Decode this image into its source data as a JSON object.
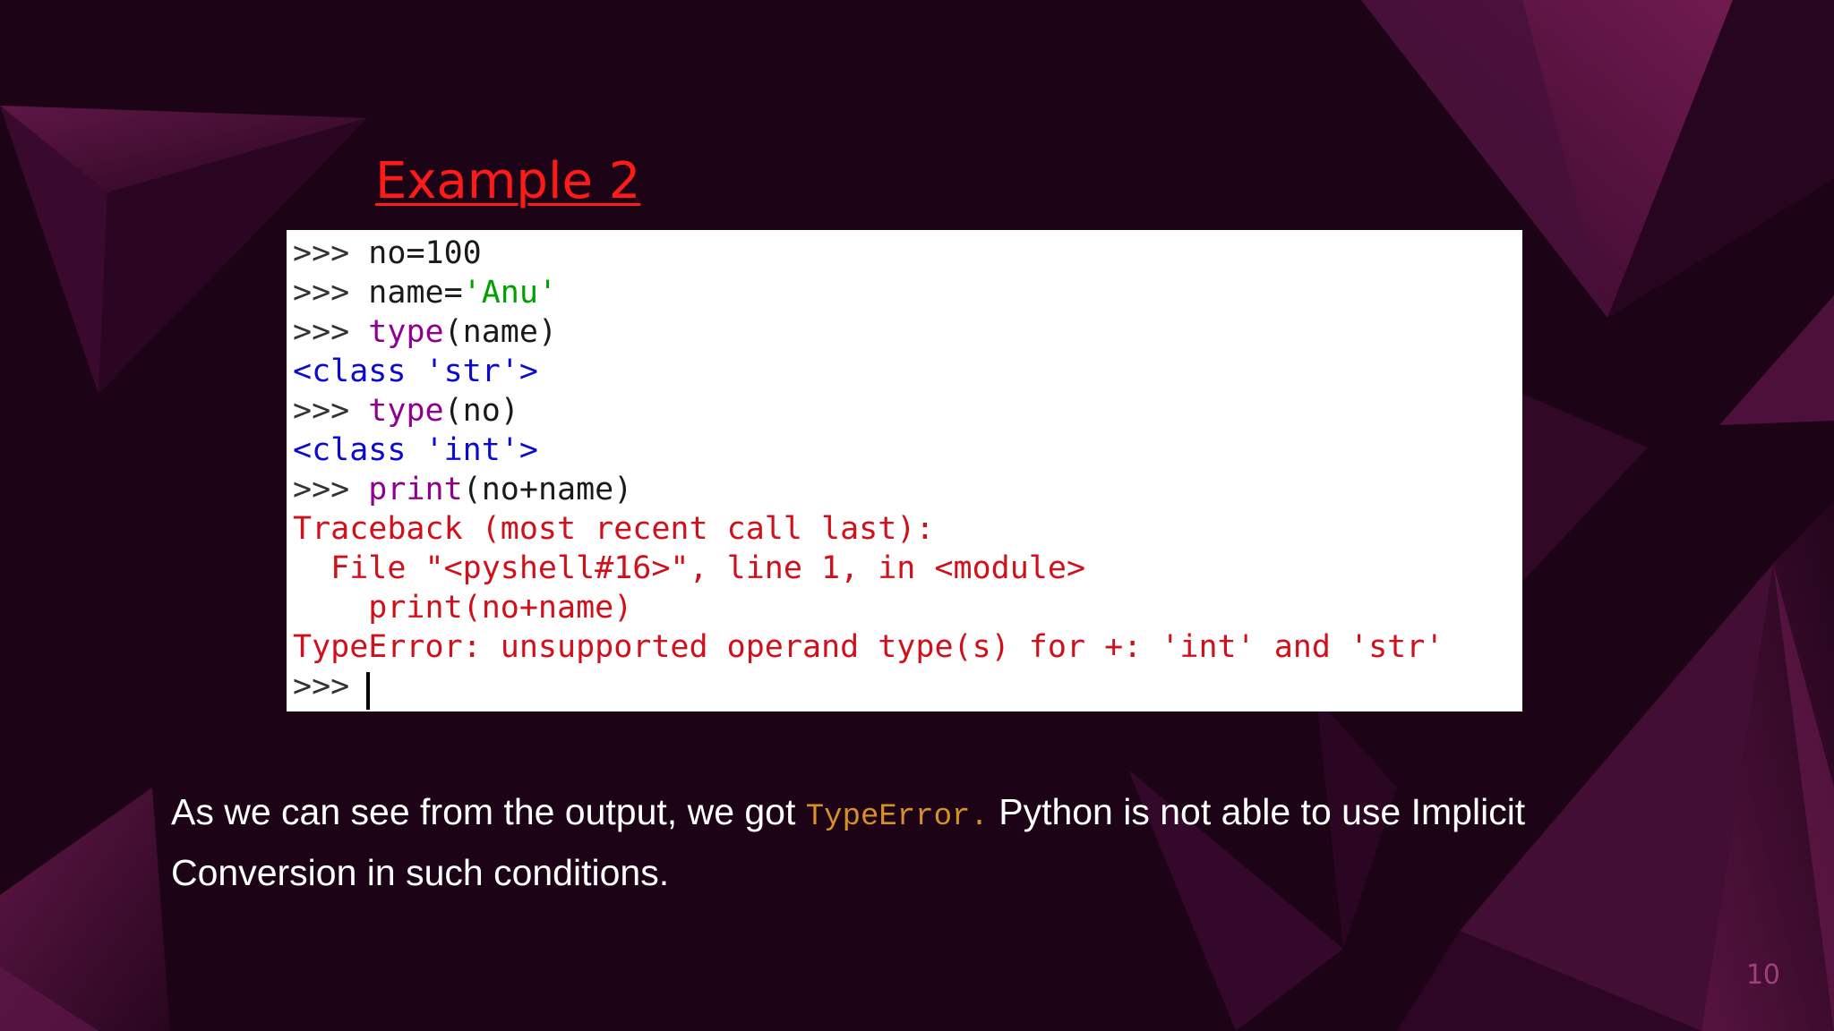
{
  "slide": {
    "title": "Example 2",
    "page_number": "10"
  },
  "shell": {
    "lines": [
      {
        "prompt": ">>> ",
        "a": "no=100",
        "b": "",
        "c": ""
      },
      {
        "prompt": ">>> ",
        "a": "name=",
        "b": "'Anu'",
        "c": ""
      },
      {
        "prompt": ">>> ",
        "a": "type",
        "b": "(name)",
        "c": ""
      },
      {
        "output": "<class 'str'>"
      },
      {
        "prompt": ">>> ",
        "a": "type",
        "b": "(no)",
        "c": ""
      },
      {
        "output": "<class 'int'>"
      },
      {
        "prompt": ">>> ",
        "a": "print",
        "b": "(no+name)",
        "c": ""
      },
      {
        "error": "Traceback (most recent call last):"
      },
      {
        "error": "  File \"<pyshell#16>\", line 1, in <module>"
      },
      {
        "error": "    print(no+name)"
      },
      {
        "error": "TypeError: unsupported operand type(s) for +: 'int' and 'str'"
      },
      {
        "prompt": ">>> "
      }
    ]
  },
  "paragraph": {
    "before": "As we can see from the output, we got ",
    "code": "TypeError.",
    "after": " Python is not able to use Implicit Conversion in such conditions."
  }
}
